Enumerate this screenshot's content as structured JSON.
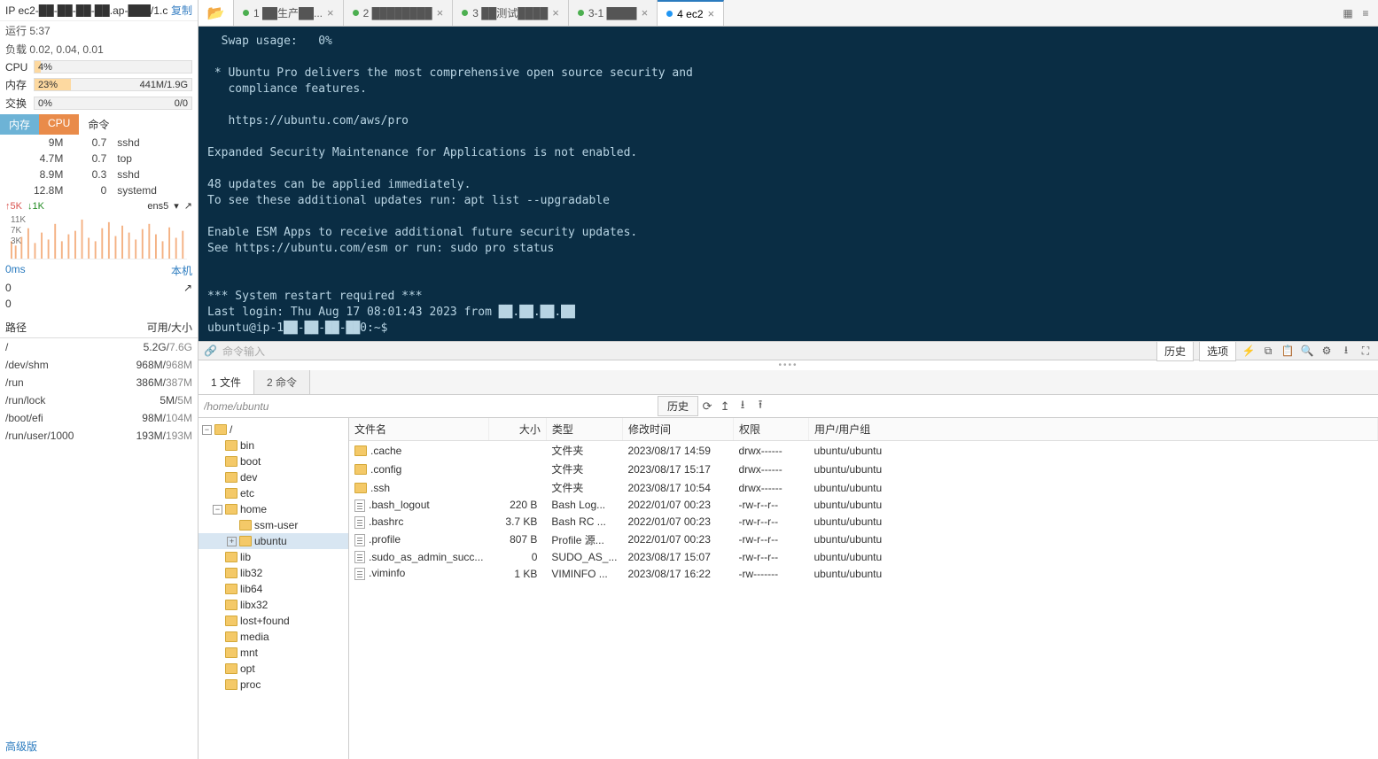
{
  "sidebar": {
    "ip": "IP ec2-██-██-██-██.ap-███/1.co...",
    "copy": "复制",
    "uptime": "运行 5:37",
    "load": "负载 0.02, 0.04, 0.01",
    "cpu_label": "CPU",
    "cpu_pct": "4%",
    "mem_label": "内存",
    "mem_pct": "23%",
    "mem_val": "441M/1.9G",
    "swap_label": "交换",
    "swap_pct": "0%",
    "swap_val": "0/0",
    "tabs": {
      "mem": "内存",
      "cpu": "CPU",
      "cmd": "命令"
    },
    "procs": [
      {
        "m": "9M",
        "c": "0.7",
        "n": "sshd"
      },
      {
        "m": "4.7M",
        "c": "0.7",
        "n": "top"
      },
      {
        "m": "8.9M",
        "c": "0.3",
        "n": "sshd"
      },
      {
        "m": "12.8M",
        "c": "0",
        "n": "systemd"
      }
    ],
    "net_up": "5K",
    "net_dn": "1K",
    "net_if": "ens5",
    "lat_ms": "0ms",
    "lat_lbl": "本机",
    "lat0a": "0",
    "lat0b": "0",
    "spark_ticks": [
      "11K",
      "7K",
      "3K"
    ],
    "path_h1": "路径",
    "path_h2": "可用/大小",
    "paths": [
      {
        "p": "/",
        "s": "5.2G/7.6G"
      },
      {
        "p": "/dev/shm",
        "s": "968M/968M"
      },
      {
        "p": "/run",
        "s": "386M/387M"
      },
      {
        "p": "/run/lock",
        "s": "5M/5M"
      },
      {
        "p": "/boot/efi",
        "s": "98M/104M"
      },
      {
        "p": "/run/user/1000",
        "s": "193M/193M"
      }
    ],
    "adv": "高级版"
  },
  "tabs": [
    {
      "label": "1 ██生产██...",
      "dot": "green"
    },
    {
      "label": "2 ████████",
      "dot": "green"
    },
    {
      "label": "3 ██测试████",
      "dot": "green"
    },
    {
      "label": "3-1 ████",
      "dot": "green"
    },
    {
      "label": "4 ec2",
      "dot": "blue",
      "active": true
    }
  ],
  "terminal": "  Swap usage:   0%\n\n * Ubuntu Pro delivers the most comprehensive open source security and\n   compliance features.\n\n   https://ubuntu.com/aws/pro\n\nExpanded Security Maintenance for Applications is not enabled.\n\n48 updates can be applied immediately.\nTo see these additional updates run: apt list --upgradable\n\nEnable ESM Apps to receive additional future security updates.\nSee https://ubuntu.com/esm or run: sudo pro status\n\n\n*** System restart required ***\nLast login: Thu Aug 17 08:01:43 2023 from ██.██.██.██\nubuntu@ip-1██-██-██-██0:~$ ",
  "termbar": {
    "cmd_ph": "命令输入",
    "hist": "历史",
    "opt": "选项"
  },
  "filetabs": {
    "t1": "1 文件",
    "t2": "2 命令"
  },
  "pathbar": {
    "value": "/home/ubuntu",
    "hist": "历史"
  },
  "tree": {
    "root": "/",
    "items": [
      "bin",
      "boot",
      "dev",
      "etc",
      "home",
      "lib",
      "lib32",
      "lib64",
      "libx32",
      "lost+found",
      "media",
      "mnt",
      "opt",
      "proc"
    ],
    "home_children": [
      "ssm-user",
      "ubuntu"
    ],
    "selected": "ubuntu"
  },
  "cols": {
    "name": "文件名",
    "size": "大小",
    "type": "类型",
    "mtime": "修改时间",
    "perm": "权限",
    "owner": "用户/用户组"
  },
  "files": [
    {
      "ico": "d",
      "n": ".cache",
      "s": "",
      "t": "文件夹",
      "m": "2023/08/17 14:59",
      "p": "drwx------",
      "o": "ubuntu/ubuntu"
    },
    {
      "ico": "d",
      "n": ".config",
      "s": "",
      "t": "文件夹",
      "m": "2023/08/17 15:17",
      "p": "drwx------",
      "o": "ubuntu/ubuntu"
    },
    {
      "ico": "d",
      "n": ".ssh",
      "s": "",
      "t": "文件夹",
      "m": "2023/08/17 10:54",
      "p": "drwx------",
      "o": "ubuntu/ubuntu"
    },
    {
      "ico": "f",
      "n": ".bash_logout",
      "s": "220 B",
      "t": "Bash Log...",
      "m": "2022/01/07 00:23",
      "p": "-rw-r--r--",
      "o": "ubuntu/ubuntu"
    },
    {
      "ico": "f",
      "n": ".bashrc",
      "s": "3.7 KB",
      "t": "Bash RC ...",
      "m": "2022/01/07 00:23",
      "p": "-rw-r--r--",
      "o": "ubuntu/ubuntu"
    },
    {
      "ico": "f",
      "n": ".profile",
      "s": "807 B",
      "t": "Profile 源...",
      "m": "2022/01/07 00:23",
      "p": "-rw-r--r--",
      "o": "ubuntu/ubuntu"
    },
    {
      "ico": "f",
      "n": ".sudo_as_admin_succ...",
      "s": "0",
      "t": "SUDO_AS_...",
      "m": "2023/08/17 15:07",
      "p": "-rw-r--r--",
      "o": "ubuntu/ubuntu"
    },
    {
      "ico": "f",
      "n": ".viminfo",
      "s": "1 KB",
      "t": "VIMINFO ...",
      "m": "2023/08/17 16:22",
      "p": "-rw-------",
      "o": "ubuntu/ubuntu"
    }
  ]
}
